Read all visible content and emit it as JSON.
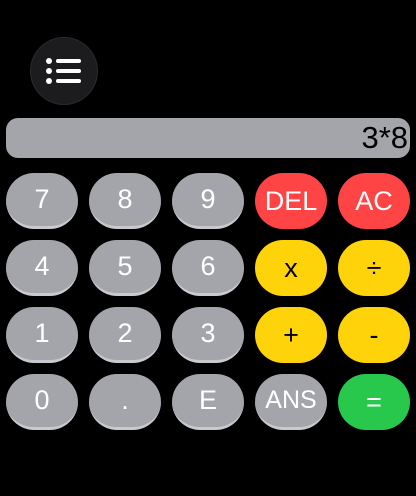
{
  "menu": {
    "icon": "list-icon"
  },
  "display": {
    "expression": "3*8"
  },
  "keys": {
    "k7": "7",
    "k8": "8",
    "k9": "9",
    "del": "DEL",
    "ac": "AC",
    "k4": "4",
    "k5": "5",
    "k6": "6",
    "multiply": "x",
    "divide": "÷",
    "k1": "1",
    "k2": "2",
    "k3": "3",
    "plus": "+",
    "minus": "-",
    "k0": "0",
    "dot": ".",
    "exp": "E",
    "ans": "ANS",
    "equals": "="
  },
  "colors": {
    "number_key": "#a4a5ab",
    "operator_key": "#fed30a",
    "clear_key": "#fe4445",
    "equals_key": "#27c84c",
    "display_bg": "#a4a5ab"
  }
}
